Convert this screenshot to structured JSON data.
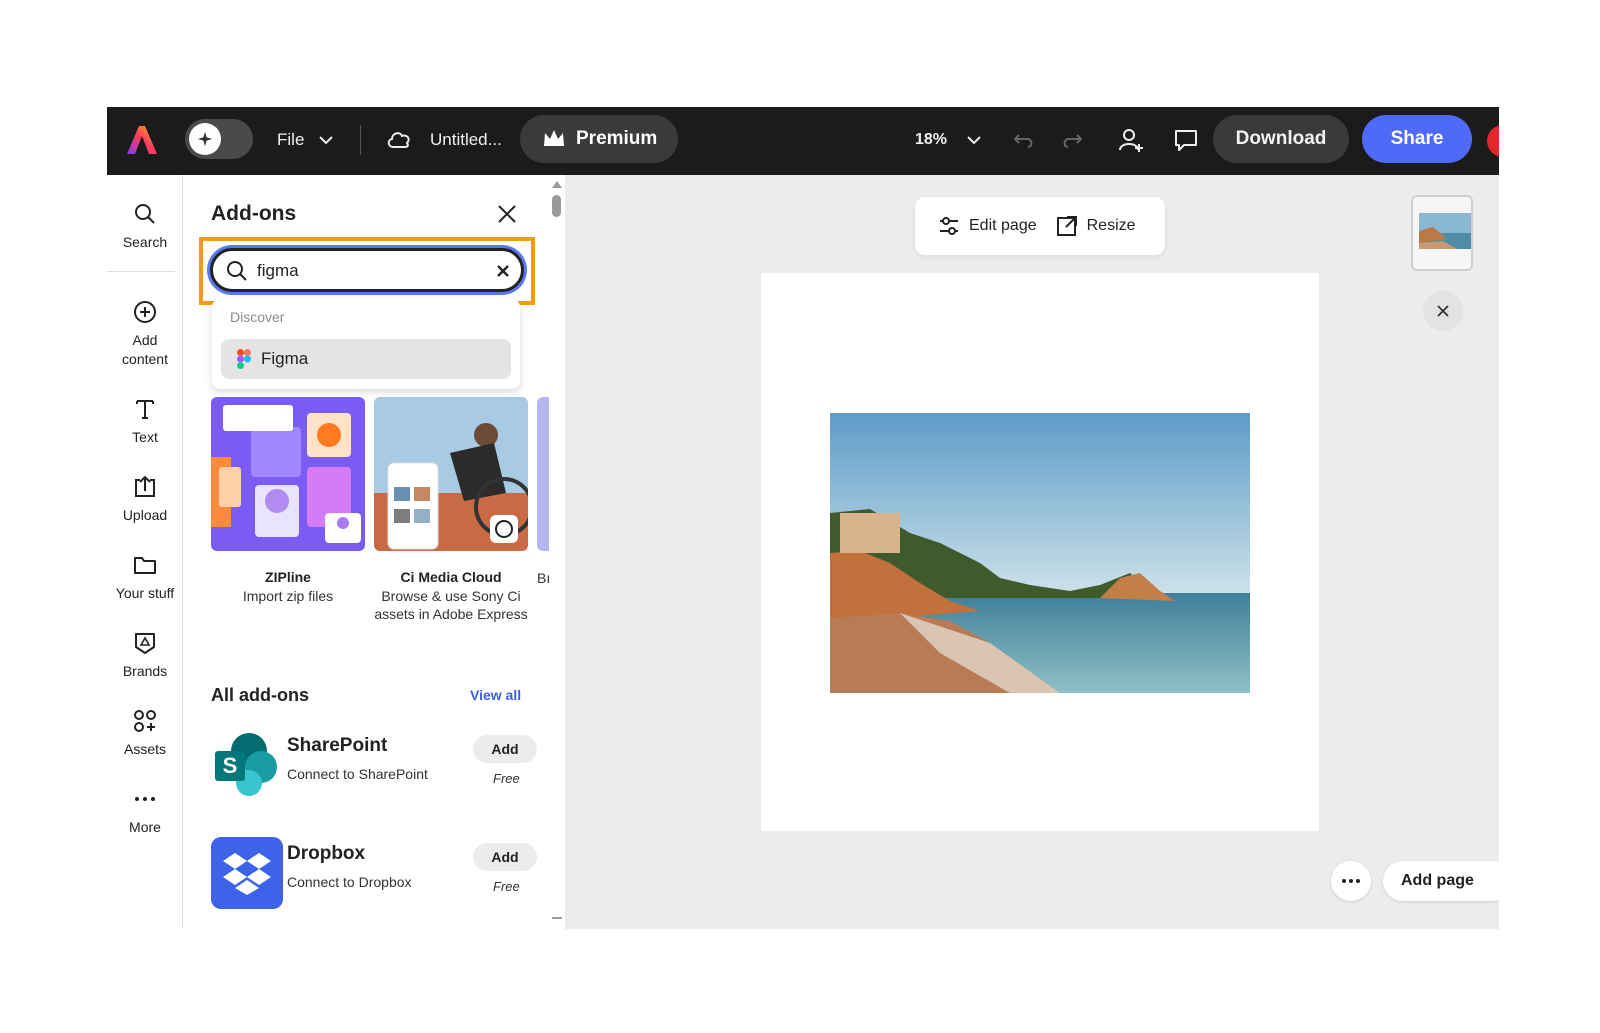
{
  "topbar": {
    "file_label": "File",
    "document_title": "Untitled...",
    "premium_label": "Premium",
    "zoom_label": "18%",
    "download_label": "Download",
    "share_label": "Share",
    "share_color": "#4f6af6"
  },
  "rail": {
    "items": [
      {
        "label": "Search",
        "icon": "search-icon"
      },
      {
        "label": "Add\ncontent",
        "icon": "plus-circle-icon"
      },
      {
        "label": "Text",
        "icon": "text-icon"
      },
      {
        "label": "Upload",
        "icon": "upload-icon"
      },
      {
        "label": "Your stuff",
        "icon": "folder-icon"
      },
      {
        "label": "Brands",
        "icon": "brands-icon"
      },
      {
        "label": "Assets",
        "icon": "assets-icon"
      },
      {
        "label": "More",
        "icon": "more-icon"
      }
    ]
  },
  "panel": {
    "title": "Add-ons",
    "search_value": "figma",
    "dropdown_label": "Discover",
    "dropdown_item": "Figma",
    "highlight_color": "#f39a1c",
    "featured": [
      {
        "name": "ZIPline",
        "desc": "Import zip files"
      },
      {
        "name": "Ci Media Cloud",
        "desc": "Browse & use Sony Ci assets in Adobe Express"
      },
      {
        "name": "",
        "desc": "Bı"
      }
    ],
    "all_title": "All add-ons",
    "view_all": "View all",
    "addons": [
      {
        "name": "SharePoint",
        "desc": "Connect to SharePoint",
        "button": "Add",
        "price": "Free"
      },
      {
        "name": "Dropbox",
        "desc": "Connect to Dropbox",
        "button": "Add",
        "price": "Free"
      }
    ]
  },
  "canvas": {
    "edit_page_label": "Edit page",
    "resize_label": "Resize",
    "add_page_label": "Add page"
  }
}
